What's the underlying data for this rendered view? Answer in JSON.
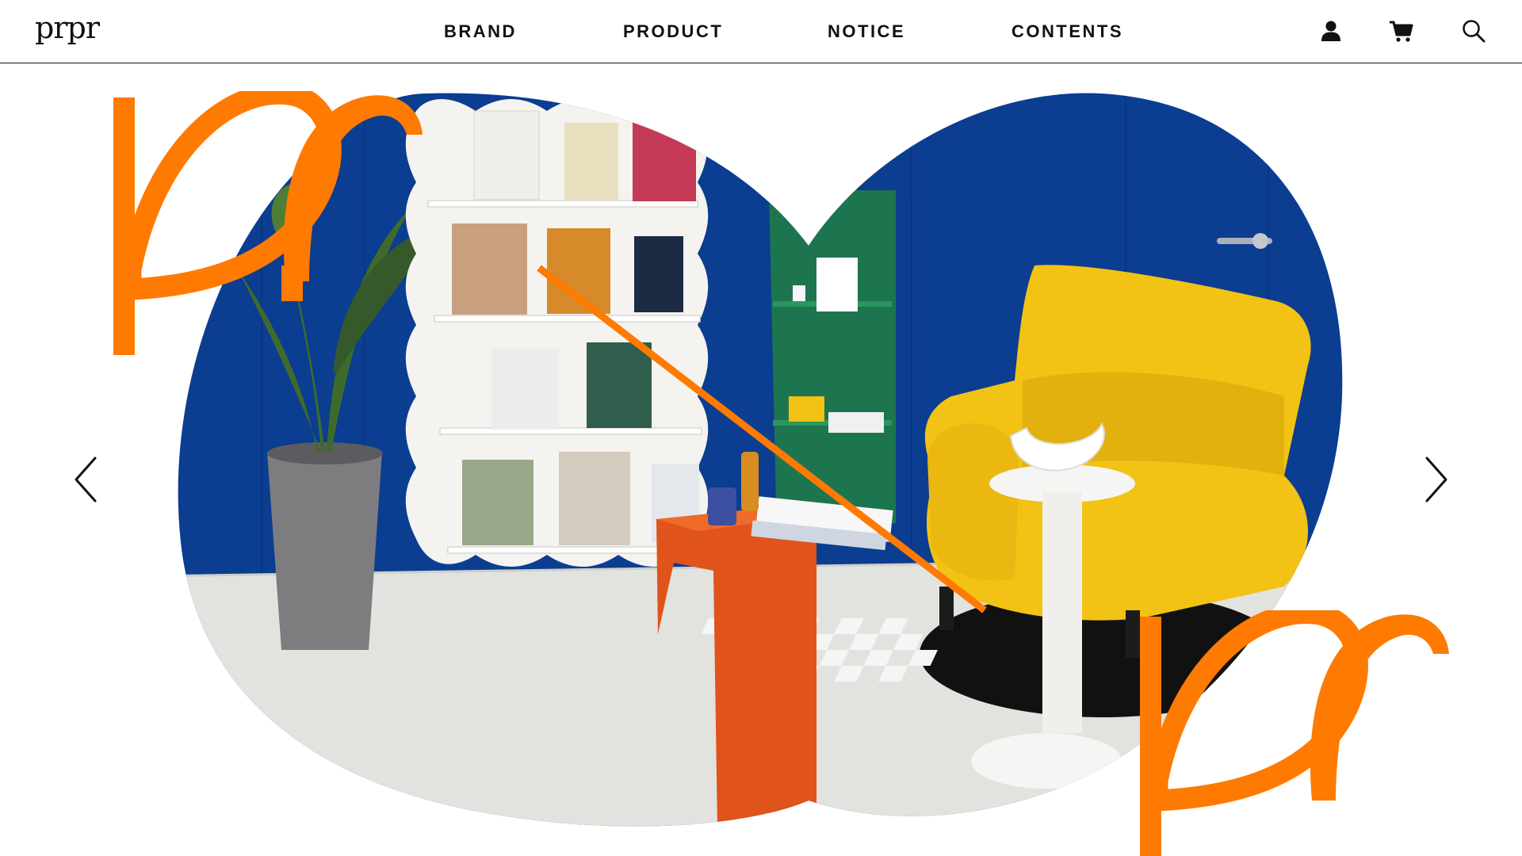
{
  "header": {
    "logo_text": "prpr",
    "nav": [
      {
        "label": "BRAND"
      },
      {
        "label": "PRODUCT"
      },
      {
        "label": "NOTICE"
      },
      {
        "label": "CONTENTS"
      }
    ],
    "icons": [
      "user-icon",
      "cart-icon",
      "search-icon"
    ]
  },
  "hero": {
    "brand_mark_top": "pr",
    "brand_mark_bottom": "pr",
    "colors": {
      "accent": "#ff7a00",
      "wall_blue": "#0b3d91",
      "chair_yellow": "#f2c214",
      "floor_grey": "#e2e2df",
      "shelf_white": "#f4f3ef",
      "plant_green": "#3f6b2a",
      "acrylic_green": "#1f7a4a",
      "table_orange": "#e0531a"
    },
    "prev_icon": "chevron-left-icon",
    "next_icon": "chevron-right-icon"
  }
}
